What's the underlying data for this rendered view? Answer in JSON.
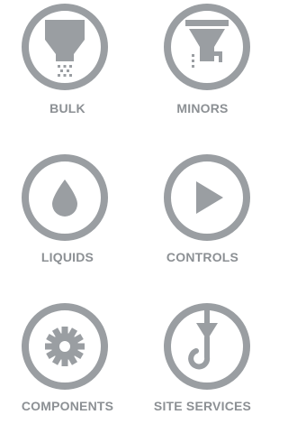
{
  "colors": {
    "icon": "#9a9ea2",
    "label": "#8c9094",
    "background": "#ffffff"
  },
  "tiles": [
    {
      "label": "BULK",
      "icon": "bulk-hopper-icon"
    },
    {
      "label": "MINORS",
      "icon": "minors-hopper-icon"
    },
    {
      "label": "LIQUIDS",
      "icon": "droplet-icon"
    },
    {
      "label": "CONTROLS",
      "icon": "play-icon"
    },
    {
      "label": "COMPONENTS",
      "icon": "gear-icon"
    },
    {
      "label": "SITE SERVICES",
      "icon": "crane-hook-icon"
    }
  ]
}
